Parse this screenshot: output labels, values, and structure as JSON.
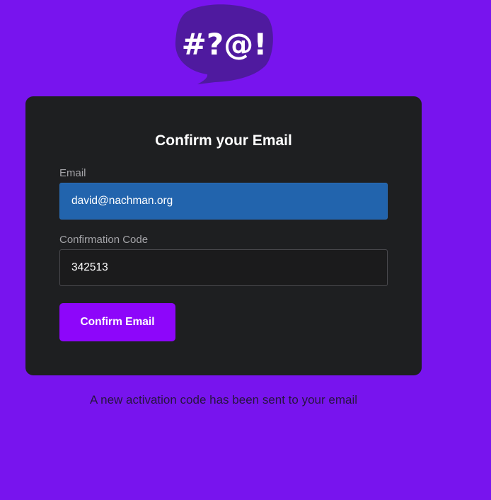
{
  "logo": {
    "text": "#?@!",
    "icon": "speech-bubble-icon"
  },
  "form": {
    "title": "Confirm your Email",
    "email": {
      "label": "Email",
      "value": "david@nachman.org"
    },
    "code": {
      "label": "Confirmation Code",
      "value": "342513"
    },
    "submit_label": "Confirm Email"
  },
  "status": {
    "message": "A new activation code has been sent to your email"
  },
  "colors": {
    "background": "#7814ee",
    "card": "#1e1f21",
    "button": "#8d06fa",
    "email_field": "#2264ad",
    "logo_bubble": "#4f1a9f"
  }
}
